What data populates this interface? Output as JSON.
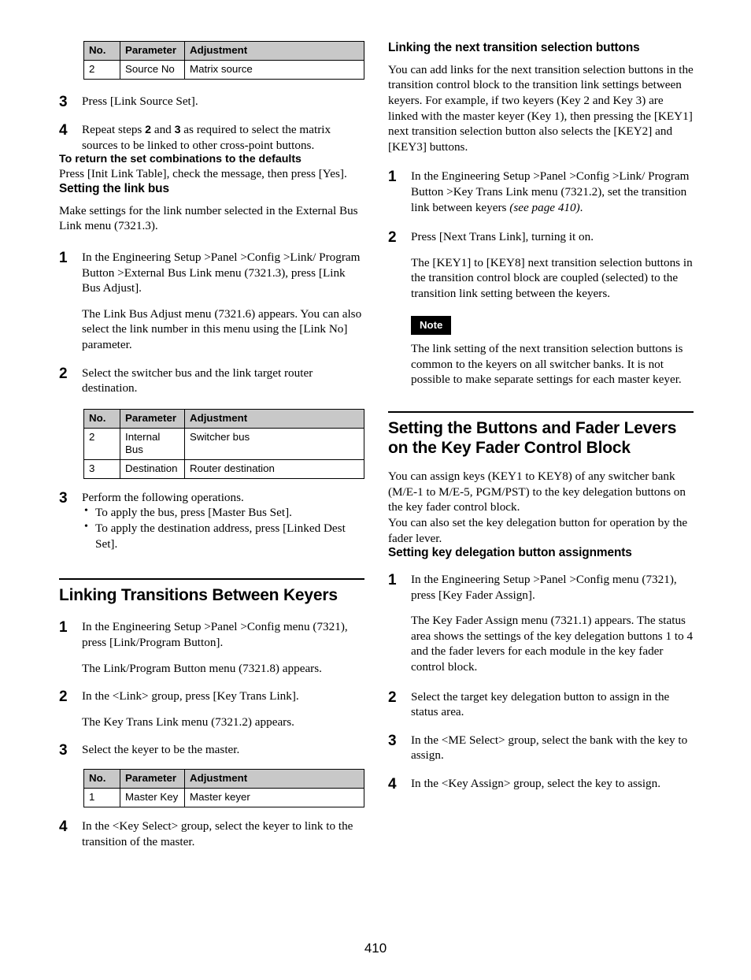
{
  "page": {
    "number": "410"
  },
  "tables": {
    "headers": [
      "No.",
      "Parameter",
      "Adjustment"
    ],
    "source_no": {
      "rows": [
        [
          "2",
          "Source No",
          "Matrix source"
        ]
      ]
    },
    "link_bus": {
      "rows": [
        [
          "2",
          "Internal Bus",
          "Switcher bus"
        ],
        [
          "3",
          "Destination",
          "Router destination"
        ]
      ]
    },
    "master_key": {
      "rows": [
        [
          "1",
          "Master Key",
          "Master keyer"
        ]
      ]
    }
  },
  "left_column": {
    "step3_link_source": {
      "num": "3",
      "text": "Press [Link Source Set]."
    },
    "step4_repeat": {
      "num": "4",
      "text_part1": "Repeat steps ",
      "bold_2": "2",
      "text_and": " and ",
      "bold_3": "3",
      "text_part2": " as required to select the matrix sources to be linked to other cross-point buttons."
    },
    "return_defaults": {
      "heading": "To return the set combinations to the defaults",
      "text": "Press [Init Link Table], check the message, then press [Yes]."
    },
    "setting_link_bus": {
      "heading": "Setting the link bus",
      "intro": "Make settings for the link number selected in the External Bus Link menu (7321.3).",
      "step1": {
        "num": "1",
        "text": "In the Engineering Setup >Panel >Config >Link/ Program Button >External Bus Link menu (7321.3), press [Link Bus Adjust].",
        "text2": "The Link Bus Adjust menu (7321.6) appears. You can also select the link number in this menu using the [Link No] parameter."
      },
      "step2": {
        "num": "2",
        "text": "Select the switcher bus and the link target router destination."
      },
      "step3": {
        "num": "3",
        "text": "Perform the following operations.",
        "bullets": [
          "To apply the bus, press [Master Bus Set].",
          "To apply the destination address, press [Linked Dest Set]."
        ]
      }
    },
    "linking_transitions": {
      "heading": "Linking Transitions Between Keyers",
      "step1": {
        "num": "1",
        "text": "In the Engineering Setup >Panel >Config menu (7321), press [Link/Program Button].",
        "text2": "The Link/Program Button menu (7321.8) appears."
      },
      "step2": {
        "num": "2",
        "text": "In the <Link> group, press [Key Trans Link].",
        "text2": "The Key Trans Link menu (7321.2) appears."
      },
      "step3": {
        "num": "3",
        "text": "Select the keyer to be the master."
      },
      "step4": {
        "num": "4",
        "text": "In the <Key Select> group, select the keyer to link to the transition of the master."
      }
    }
  },
  "right_column": {
    "linking_next_transition": {
      "heading": "Linking the next transition selection buttons",
      "intro": "You can add links for the next transition selection buttons in the transition control block to the transition link settings between keyers. For example, if two keyers (Key 2 and Key 3) are linked with the master keyer (Key 1), then pressing the [KEY1] next transition selection button also selects the [KEY2] and [KEY3] buttons.",
      "step1": {
        "num": "1",
        "text": "In the Engineering Setup >Panel >Config >Link/ Program Button >Key Trans Link menu (7321.2), set the transition link between keyers ",
        "ref": "(see page 410)",
        "text_end": "."
      },
      "step2": {
        "num": "2",
        "text": "Press [Next Trans Link], turning it on.",
        "text2": "The [KEY1] to [KEY8] next transition selection buttons in the transition control block are coupled (selected) to the transition link setting between the keyers.",
        "note_label": "Note",
        "note_text": "The link setting of the next transition selection buttons is common to the keyers on all switcher banks. It is not possible to make separate settings for each master keyer."
      }
    },
    "setting_buttons_fader": {
      "heading": "Setting the Buttons and Fader Levers on the Key Fader Control Block",
      "intro1": "You can assign keys (KEY1 to KEY8) of any switcher bank (M/E-1 to M/E-5, PGM/PST) to the key delegation buttons on the key fader control block.",
      "intro2": "You can also set the key delegation button for operation by the fader lever."
    },
    "key_delegation": {
      "heading": "Setting key delegation button assignments",
      "step1": {
        "num": "1",
        "text": "In the Engineering Setup >Panel >Config menu (7321), press [Key Fader Assign].",
        "text2": "The Key Fader Assign menu (7321.1) appears. The status area shows the settings of the key delegation buttons 1 to 4 and the fader levers for each module in the key fader control block."
      },
      "step2": {
        "num": "2",
        "text": "Select the target key delegation button to assign in the status area."
      },
      "step3": {
        "num": "3",
        "text": "In the <ME Select> group, select the bank with the key to assign."
      },
      "step4": {
        "num": "4",
        "text": "In the <Key Assign> group, select the key to assign."
      }
    }
  }
}
